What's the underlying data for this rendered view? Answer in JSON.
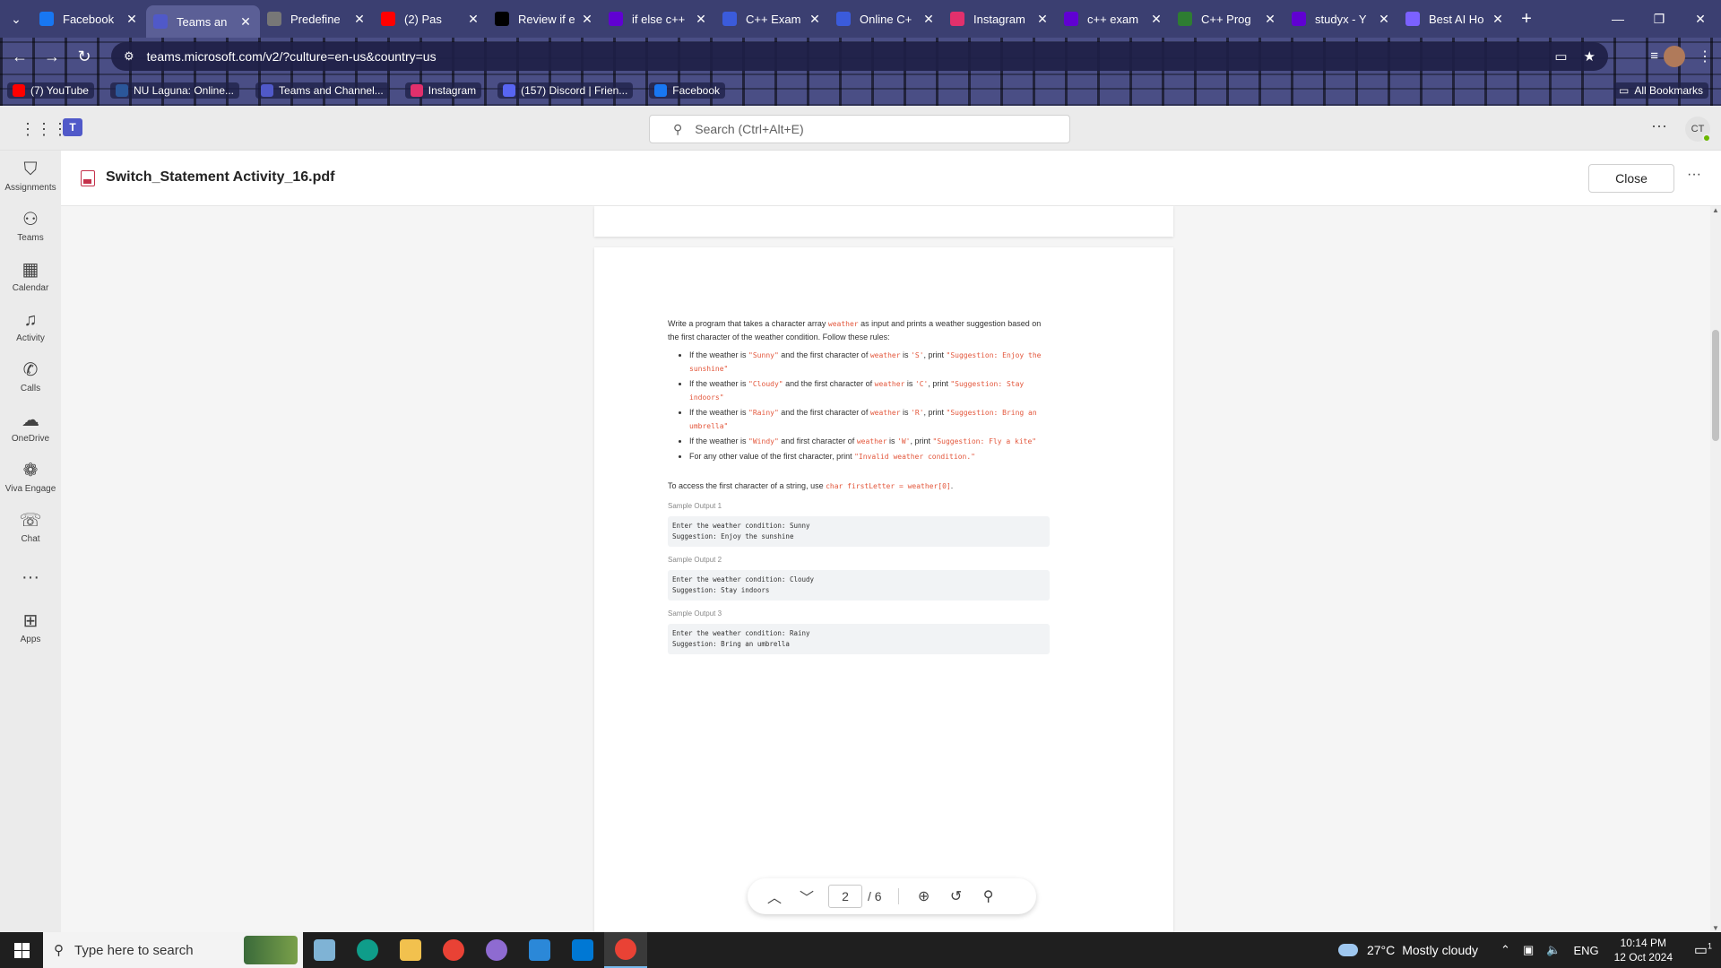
{
  "browser": {
    "tabs": [
      {
        "title": "Facebook",
        "favicon": "facebook-icon",
        "color": "#1877f2",
        "active": false
      },
      {
        "title": "Teams an",
        "favicon": "teams-icon",
        "color": "#5059c9",
        "active": true
      },
      {
        "title": "Predefine",
        "favicon": "generic-icon",
        "color": "#777777",
        "active": false
      },
      {
        "title": "(2) Pas",
        "favicon": "youtube-icon",
        "color": "#ff0000",
        "active": false
      },
      {
        "title": "Review if e",
        "favicon": "notion-icon",
        "color": "#000000",
        "active": false
      },
      {
        "title": "if else c++",
        "favicon": "yahoo-icon",
        "color": "#6001d2",
        "active": false
      },
      {
        "title": "C++ Exam",
        "favicon": "pencil-icon",
        "color": "#3b5bdb",
        "active": false
      },
      {
        "title": "Online C+",
        "favicon": "pencil-icon",
        "color": "#3b5bdb",
        "active": false
      },
      {
        "title": "Instagram",
        "favicon": "instagram-icon",
        "color": "#e1306c",
        "active": false
      },
      {
        "title": "c++ exam",
        "favicon": "yahoo-icon",
        "color": "#6001d2",
        "active": false
      },
      {
        "title": "C++ Prog",
        "favicon": "generic-icon",
        "color": "#2e7d32",
        "active": false
      },
      {
        "title": "studyx - Y",
        "favicon": "yahoo-icon",
        "color": "#6001d2",
        "active": false
      },
      {
        "title": "Best AI Ho",
        "favicon": "ai-icon",
        "color": "#7b61ff",
        "active": false
      }
    ],
    "url": "teams.microsoft.com/v2/?culture=en-us&country=us",
    "bookmarks": [
      {
        "label": "(7) YouTube",
        "color": "#ff0000"
      },
      {
        "label": "NU Laguna: Online...",
        "color": "#2b579a"
      },
      {
        "label": "Teams and Channel...",
        "color": "#5059c9"
      },
      {
        "label": "Instagram",
        "color": "#e1306c"
      },
      {
        "label": "(157) Discord | Frien...",
        "color": "#5865f2"
      },
      {
        "label": "Facebook",
        "color": "#1877f2"
      }
    ],
    "all_bookmarks": "All Bookmarks"
  },
  "teams": {
    "search_placeholder": "Search (Ctrl+Alt+E)",
    "avatar_initials": "CT",
    "rail": [
      {
        "label": "Assignments",
        "icon": "backpack-icon",
        "glyph": "⛉"
      },
      {
        "label": "Teams",
        "icon": "teams-people-icon",
        "glyph": "⚇"
      },
      {
        "label": "Calendar",
        "icon": "calendar-icon",
        "glyph": "▦"
      },
      {
        "label": "Activity",
        "icon": "bell-icon",
        "glyph": "♫"
      },
      {
        "label": "Calls",
        "icon": "phone-icon",
        "glyph": "✆"
      },
      {
        "label": "OneDrive",
        "icon": "cloud-icon",
        "glyph": "☁"
      },
      {
        "label": "Viva Engage",
        "icon": "viva-engage-icon",
        "glyph": "❁"
      },
      {
        "label": "Chat",
        "icon": "chat-icon",
        "glyph": "☏"
      },
      {
        "label": "",
        "icon": "more-apps-icon",
        "glyph": "···"
      },
      {
        "label": "Apps",
        "icon": "apps-add-icon",
        "glyph": "⊞"
      }
    ]
  },
  "file": {
    "name": "Switch_Statement Activity_16.pdf",
    "close_label": "Close"
  },
  "document": {
    "intro_1": "Write a program that takes a character array ",
    "intro_code": "weather",
    "intro_2": " as input and prints a weather suggestion based on the first character of the weather condition. Follow these rules:",
    "rules": [
      {
        "a": "If the weather is ",
        "b": "\"Sunny\"",
        "c": " and the first character of ",
        "d": "weather",
        "e": " is ",
        "f": "'S'",
        "g": ", print ",
        "h": "\"Suggestion: Enjoy the sunshine\""
      },
      {
        "a": "If the weather is ",
        "b": "\"Cloudy\"",
        "c": " and the first character of ",
        "d": "weather",
        "e": " is ",
        "f": "'C'",
        "g": ", print ",
        "h": "\"Suggestion: Stay indoors\""
      },
      {
        "a": "If the weather is ",
        "b": "\"Rainy\"",
        "c": " and the first character of ",
        "d": "weather",
        "e": " is ",
        "f": "'R'",
        "g": ", print ",
        "h": "\"Suggestion: Bring an umbrella\""
      },
      {
        "a": "If the weather is ",
        "b": "\"Windy\"",
        "c": " and first character of ",
        "d": "weather",
        "e": " is ",
        "f": "'W'",
        "g": ", print ",
        "h": "\"Suggestion: Fly a kite\""
      }
    ],
    "rule_last_1": "For any other value of the first character, print ",
    "rule_last_code": "\"Invalid weather condition.\"",
    "access_1": "To access the first character of a string, use ",
    "access_code": "char firstLetter = weather[0]",
    "access_2": ".",
    "samples": [
      {
        "label": "Sample Output 1",
        "line1": "Enter the weather condition: Sunny",
        "line2": "Suggestion: Enjoy the sunshine"
      },
      {
        "label": "Sample Output 2",
        "line1": "Enter the weather condition: Cloudy",
        "line2": "Suggestion: Stay indoors"
      },
      {
        "label": "Sample Output 3",
        "line1": "Enter the weather condition: Rainy",
        "line2": "Suggestion: Bring an umbrella"
      }
    ]
  },
  "pager": {
    "current": "2",
    "total": "/ 6"
  },
  "taskbar": {
    "search_placeholder": "Type here to search",
    "apps": [
      {
        "name": "notepad-icon",
        "color": "#7fb3d5"
      },
      {
        "name": "edge-icon",
        "color": "#0f9d8a"
      },
      {
        "name": "file-explorer-icon",
        "color": "#f2c14e"
      },
      {
        "name": "chrome-icon",
        "color": "#e94235"
      },
      {
        "name": "browser-icon",
        "color": "#8e6bd1"
      },
      {
        "name": "mail-icon",
        "color": "#2b88d8"
      },
      {
        "name": "store-icon",
        "color": "#0078d4"
      },
      {
        "name": "chrome-active-icon",
        "color": "#e94235"
      }
    ],
    "weather_temp": "27°C",
    "weather_text": "Mostly cloudy",
    "lang": "ENG",
    "time": "10:14 PM",
    "date": "12 Oct 2024",
    "notif_count": "1"
  }
}
